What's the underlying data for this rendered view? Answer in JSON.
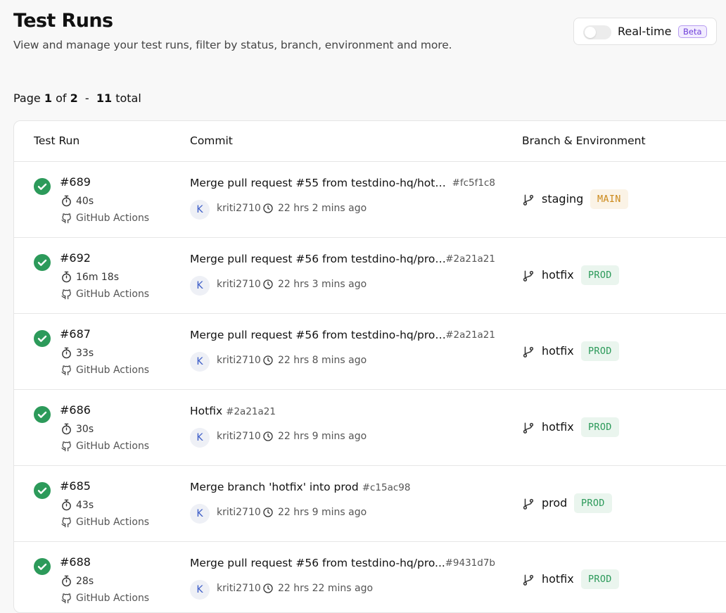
{
  "header": {
    "title": "Test Runs",
    "subtitle": "View and manage your test runs, filter by status, branch, environment and more."
  },
  "realtime": {
    "label": "Real-time",
    "badge": "Beta",
    "enabled": false
  },
  "pagination": {
    "page_label": "Page",
    "page": "1",
    "of_label": "of",
    "pages": "2",
    "separator": "-",
    "total": "11",
    "total_label": "total"
  },
  "columns": [
    "Test Run",
    "Commit",
    "Branch & Environment"
  ],
  "colors": {
    "success": "#2c9a5a",
    "main_badge_bg": "#fbf3e6",
    "main_badge_text": "#cc8a1c",
    "prod_badge_bg": "#eaf5ee",
    "prod_badge_text": "#2c9a5a",
    "beta": "#6d3ed8"
  },
  "rows": [
    {
      "id": "#689",
      "status_icon": "check-circle-icon",
      "duration": "40s",
      "ci": "GitHub Actions",
      "message": "Merge pull request #55 from testdino-hq/hotfi...",
      "hash": "#fc5f1c8",
      "avatar": "K",
      "author": "kriti2710",
      "time": "22 hrs 2 mins ago",
      "branch": "staging",
      "env": "MAIN",
      "env_type": "main",
      "trunc": true
    },
    {
      "id": "#692",
      "status_icon": "check-circle-icon",
      "duration": "16m 18s",
      "ci": "GitHub Actions",
      "message": "Merge pull request #56 from testdino-hq/prod...",
      "hash": "#2a21a21",
      "avatar": "K",
      "author": "kriti2710",
      "time": "22 hrs 3 mins ago",
      "branch": "hotfix",
      "env": "PROD",
      "env_type": "prod",
      "trunc": true
    },
    {
      "id": "#687",
      "status_icon": "check-circle-icon",
      "duration": "33s",
      "ci": "GitHub Actions",
      "message": "Merge pull request #56 from testdino-hq/prod...",
      "hash": "#2a21a21",
      "avatar": "K",
      "author": "kriti2710",
      "time": "22 hrs 8 mins ago",
      "branch": "hotfix",
      "env": "PROD",
      "env_type": "prod",
      "trunc": true
    },
    {
      "id": "#686",
      "status_icon": "check-circle-icon",
      "duration": "30s",
      "ci": "GitHub Actions",
      "message": "Hotfix",
      "hash": "#2a21a21",
      "avatar": "K",
      "author": "kriti2710",
      "time": "22 hrs 9 mins ago",
      "branch": "hotfix",
      "env": "PROD",
      "env_type": "prod",
      "trunc": false
    },
    {
      "id": "#685",
      "status_icon": "check-circle-icon",
      "duration": "43s",
      "ci": "GitHub Actions",
      "message": "Merge branch 'hotfix' into prod",
      "hash": "#c15ac98",
      "avatar": "K",
      "author": "kriti2710",
      "time": "22 hrs 9 mins ago",
      "branch": "prod",
      "env": "PROD",
      "env_type": "prod",
      "trunc": false
    },
    {
      "id": "#688",
      "status_icon": "check-circle-icon",
      "duration": "28s",
      "ci": "GitHub Actions",
      "message": "Merge pull request #56 from testdino-hq/pro...",
      "hash": "#9431d7b",
      "avatar": "K",
      "author": "kriti2710",
      "time": "22 hrs 22 mins ago",
      "branch": "hotfix",
      "env": "PROD",
      "env_type": "prod",
      "trunc": true
    }
  ]
}
